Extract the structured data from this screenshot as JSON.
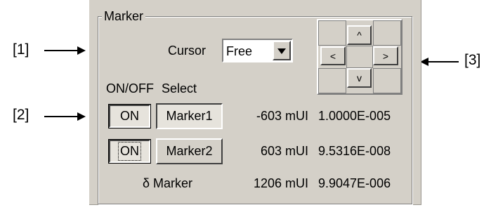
{
  "callouts": [
    "[1]",
    "[2]",
    "[3]"
  ],
  "group_title": "Marker",
  "cursor": {
    "label": "Cursor",
    "value": "Free"
  },
  "headers": {
    "onoff": "ON/OFF",
    "select": "Select"
  },
  "nav": {
    "up": "^",
    "left": "<",
    "right": ">",
    "down": "v"
  },
  "rows": [
    {
      "toggle": "ON",
      "marker": "Marker1",
      "position": "-603 mUI",
      "value": "1.0000E-005"
    },
    {
      "toggle": "ON",
      "marker": "Marker2",
      "position": "603 mUI",
      "value": "9.5316E-008"
    }
  ],
  "delta": {
    "label": "δ Marker",
    "position": "1206 mUI",
    "value": "9.9047E-006"
  }
}
